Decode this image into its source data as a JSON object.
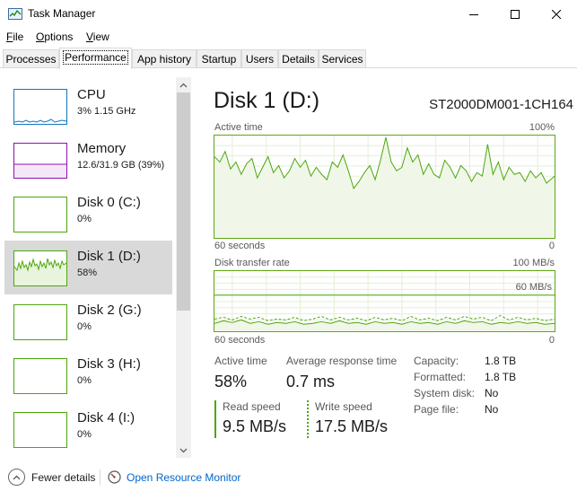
{
  "window": {
    "title": "Task Manager"
  },
  "menu": [
    {
      "label": "File",
      "accel": "F",
      "rest": "ile"
    },
    {
      "label": "Options",
      "accel": "O",
      "rest": "ptions"
    },
    {
      "label": "View",
      "accel": "V",
      "rest": "iew"
    }
  ],
  "tabs": [
    "Processes",
    "Performance",
    "App history",
    "Startup",
    "Users",
    "Details",
    "Services"
  ],
  "active_tab": "Performance",
  "sidebar": [
    {
      "name": "CPU",
      "sub": "3%  1.15 GHz",
      "color": "#1477bd"
    },
    {
      "name": "Memory",
      "sub": "12.6/31.9 GB (39%)",
      "color": "#8b12ae"
    },
    {
      "name": "Disk 0 (C:)",
      "sub": "0%",
      "color": "#4da60c"
    },
    {
      "name": "Disk 1 (D:)",
      "sub": "58%",
      "color": "#4da60c",
      "selected": true
    },
    {
      "name": "Disk 2 (G:)",
      "sub": "0%",
      "color": "#4da60c"
    },
    {
      "name": "Disk 3 (H:)",
      "sub": "0%",
      "color": "#4da60c"
    },
    {
      "name": "Disk 4 (I:)",
      "sub": "0%",
      "color": "#4da60c"
    }
  ],
  "main": {
    "title": "Disk 1 (D:)",
    "model": "ST2000DM001-1CH164",
    "active_time_graph": {
      "label": "Active time",
      "max_label": "100%",
      "time_label": "60 seconds",
      "zero_label": "0"
    },
    "transfer_graph": {
      "label": "Disk transfer rate",
      "max_label": "100 MB/s",
      "inner_label": "60 MB/s",
      "time_label": "60 seconds",
      "zero_label": "0"
    },
    "stats": {
      "active_time_label": "Active time",
      "active_time_value": "58%",
      "avg_response_label": "Average response time",
      "avg_response_value": "0.7 ms",
      "read_label": "Read speed",
      "read_value": "9.5 MB/s",
      "write_label": "Write speed",
      "write_value": "17.5 MB/s"
    },
    "info": [
      {
        "label": "Capacity:",
        "value": "1.8 TB"
      },
      {
        "label": "Formatted:",
        "value": "1.8 TB"
      },
      {
        "label": "System disk:",
        "value": "No"
      },
      {
        "label": "Page file:",
        "value": "No"
      }
    ]
  },
  "footer": {
    "fewer_details": "Fewer details",
    "open_resource_monitor": "Open Resource Monitor"
  },
  "colors": {
    "disk_accent": "#4da60c",
    "link": "#0066cc"
  }
}
